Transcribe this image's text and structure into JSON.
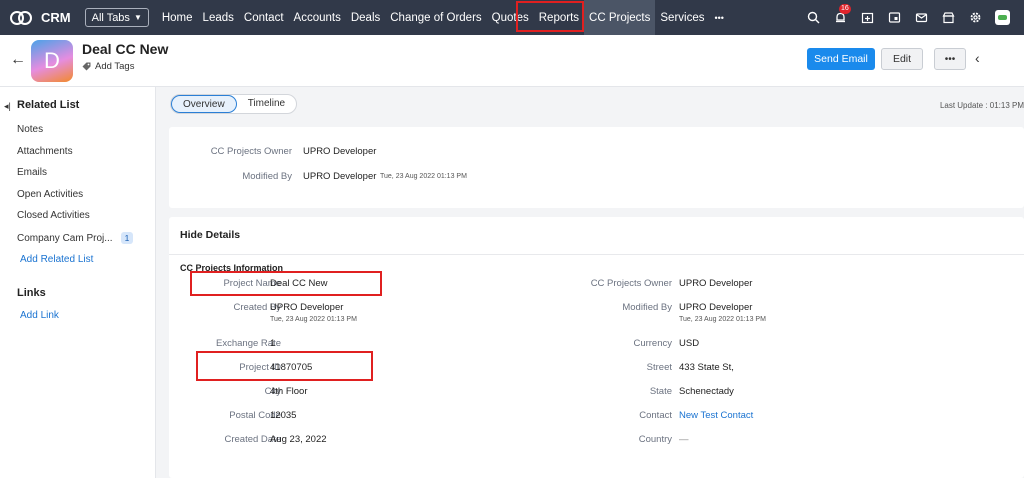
{
  "brand": {
    "name": "CRM"
  },
  "topbar": {
    "all_tabs_label": "All Tabs",
    "nav_items": [
      "Home",
      "Leads",
      "Contact",
      "Accounts",
      "Deals",
      "Change of Orders",
      "Quotes",
      "Reports",
      "CC Projects",
      "Services"
    ],
    "more_label": "•••",
    "notification_count": "16",
    "icons": [
      "search-icon",
      "bell-icon",
      "calendar-add-icon",
      "tablet-icon",
      "mail-icon",
      "store-icon",
      "gear-icon",
      "app-switcher-icon"
    ]
  },
  "header": {
    "avatar_letter": "D",
    "record_title": "Deal CC New",
    "add_tags_label": "Add Tags",
    "send_email_label": "Send Email",
    "edit_label": "Edit",
    "more_label": "•••"
  },
  "sidebar": {
    "related_list_title": "Related List",
    "items": [
      {
        "label": "Notes"
      },
      {
        "label": "Attachments"
      },
      {
        "label": "Emails"
      },
      {
        "label": "Open Activities"
      },
      {
        "label": "Closed Activities"
      },
      {
        "label": "Company Cam Proj...",
        "count": "1"
      }
    ],
    "add_related_list_label": "Add Related List",
    "links_title": "Links",
    "add_link_label": "Add Link"
  },
  "main": {
    "tabs": [
      {
        "label": "Overview",
        "active": true
      },
      {
        "label": "Timeline",
        "active": false
      }
    ],
    "last_update": "Last Update : 01:13 PM",
    "summary": {
      "owner_label": "CC Projects Owner",
      "owner_value": "UPRO Developer",
      "modified_label": "Modified By",
      "modified_value": "UPRO Developer",
      "modified_time": "Tue, 23 Aug 2022 01:13 PM"
    },
    "details": {
      "hide_details_label": "Hide Details",
      "section_title": "CC Projects Information",
      "left": [
        {
          "label": "Project Name",
          "value": "Deal CC New"
        },
        {
          "label": "Created By",
          "value": "UPRO Developer",
          "sub": "Tue, 23 Aug 2022 01:13 PM"
        },
        {
          "label": "Exchange Rate",
          "value": "1"
        },
        {
          "label": "Project ID",
          "value": "41870705"
        },
        {
          "label": "City",
          "value": "4th Floor"
        },
        {
          "label": "Postal Code",
          "value": "12035"
        },
        {
          "label": "Created Date",
          "value": "Aug 23, 2022"
        }
      ],
      "right": [
        {
          "label": "CC Projects Owner",
          "value": "UPRO Developer"
        },
        {
          "label": "Modified By",
          "value": "UPRO Developer",
          "sub": "Tue, 23 Aug 2022 01:13 PM"
        },
        {
          "label": "Currency",
          "value": "USD"
        },
        {
          "label": "Street",
          "value": "433 State St,"
        },
        {
          "label": "State",
          "value": "Schenectady"
        },
        {
          "label": "Contact",
          "value": "New Test Contact"
        },
        {
          "label": "Country",
          "value": "—"
        }
      ]
    }
  },
  "colors": {
    "topbar": "#313949",
    "accent": "#1a8aec",
    "highlight": "#e02020",
    "link": "#1a73d1"
  }
}
